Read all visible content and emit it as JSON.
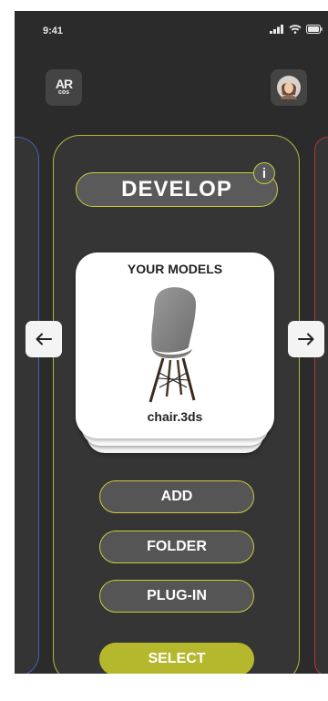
{
  "status_bar": {
    "time": "9:41"
  },
  "header": {
    "logo_line1": "AR",
    "logo_line2": "cos",
    "avatar_icon": "user-avatar"
  },
  "card": {
    "title": "DEVELOP",
    "info_label": "i",
    "models": {
      "heading": "YOUR MODELS",
      "file_name": "chair.3ds"
    },
    "buttons": {
      "add": "ADD",
      "folder": "FOLDER",
      "plugin": "PLUG-IN",
      "select": "SELECT"
    }
  },
  "colors": {
    "background": "#2b2b2b",
    "accent": "#b5b82d",
    "left_card_border": "#4a5fb8",
    "right_card_border": "#b8343a"
  },
  "icons": {
    "prev": "arrow-left-icon",
    "next": "arrow-right-icon",
    "signal": "signal-icon",
    "wifi": "wifi-icon",
    "battery": "battery-icon"
  }
}
